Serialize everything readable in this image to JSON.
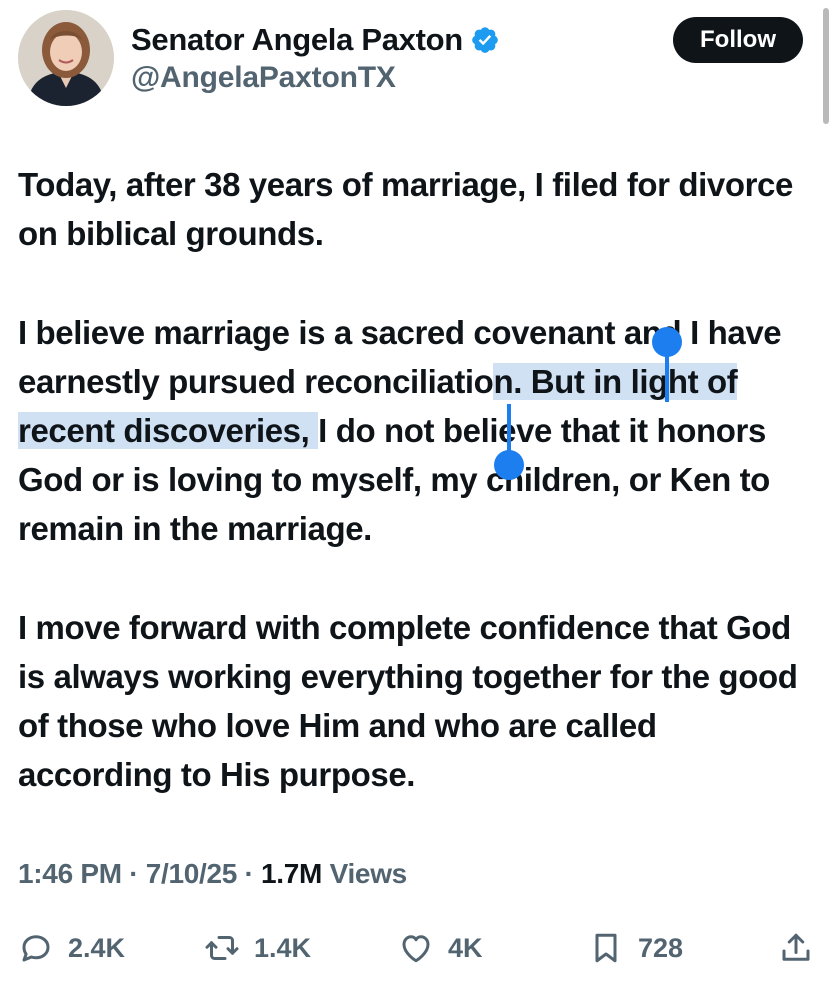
{
  "author": {
    "display_name": "Senator Angela Paxton",
    "handle": "@AngelaPaxtonTX",
    "verified_icon": "verified-badge-icon",
    "accent_color": "#1d9bf0"
  },
  "follow_button": {
    "label": "Follow"
  },
  "tweet": {
    "paragraph1": "Today, after 38 years of marriage, I filed for divorce on biblical grounds.",
    "paragraph2_before": "I believe marriage is a sacred covenant and I have earnestly pursued reconciliatio",
    "paragraph2_selected": "n. But in light of recent discoveries, ",
    "paragraph2_after": "I do not believe that it honors God or is loving to myself, my children, or Ken to remain in the marriage.",
    "paragraph3": "I move forward with complete confidence that God is always working everything together for the good of those who love Him and who are called according to His purpose."
  },
  "meta": {
    "time": "1:46 PM",
    "separator": " · ",
    "date": "7/10/25",
    "views_count": "1.7M",
    "views_label": " Views"
  },
  "actions": {
    "replies": "2.4K",
    "reposts": "1.4K",
    "likes": "4K",
    "bookmarks": "728"
  },
  "colors": {
    "text": "#0f1419",
    "secondary": "#536471",
    "selection": "#cfe1f3",
    "selection_handle": "#1d7ef0"
  }
}
